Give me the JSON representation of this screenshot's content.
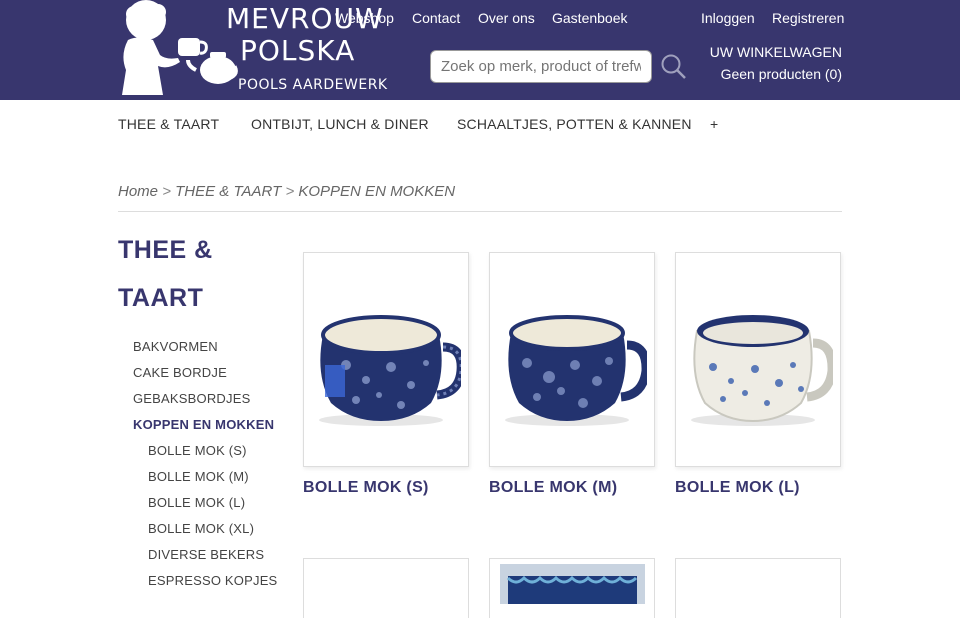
{
  "header": {
    "logo": {
      "line1": "MEVROUW",
      "line2": "POLSKA",
      "line3": "POOLS AARDEWERK"
    },
    "top_links": [
      "Webshop",
      "Contact",
      "Over ons",
      "Gastenboek"
    ],
    "account_links": [
      "Inloggen",
      "Registreren"
    ],
    "search": {
      "placeholder": "Zoek op merk, product of trefwoord",
      "icon": "search-icon"
    },
    "cart": {
      "title": "UW WINKELWAGEN",
      "status": "Geen producten (0)"
    },
    "colors": {
      "background": "#38366e",
      "text": "#ffffff"
    }
  },
  "nav": {
    "items": [
      "THEE & TAART",
      "ONTBIJT, LUNCH & DINER",
      "SCHAALTJES, POTTEN & KANNEN",
      "+"
    ]
  },
  "breadcrumb": {
    "items": [
      "Home",
      "THEE & TAART",
      "KOPPEN EN MOKKEN"
    ],
    "separator": ">"
  },
  "sidebar": {
    "title": "THEE & TAART",
    "items": [
      "BAKVORMEN",
      "CAKE BORDJE",
      "GEBAKSBORDJES",
      "KOPPEN EN MOKKEN"
    ],
    "active": "KOPPEN EN MOKKEN",
    "subitems": [
      "BOLLE MOK (S)",
      "BOLLE MOK (M)",
      "BOLLE MOK (L)",
      "BOLLE MOK (XL)",
      "DIVERSE BEKERS",
      "ESPRESSO KOPJES"
    ]
  },
  "products": [
    {
      "name": "BOLLE MOK (S)"
    },
    {
      "name": "BOLLE MOK (M)"
    },
    {
      "name": "BOLLE MOK (L)"
    }
  ],
  "theme": {
    "accent": "#38366e",
    "mug_blue": "#23336f",
    "mug_cream": "#eee9d9"
  }
}
